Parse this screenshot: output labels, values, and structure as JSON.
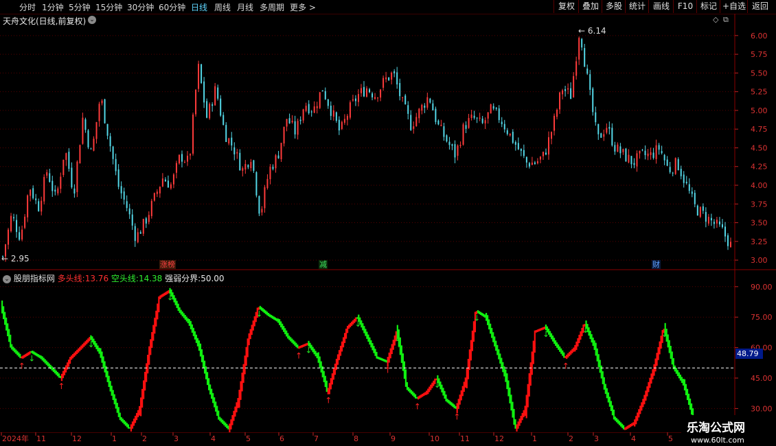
{
  "toolbar": {
    "periods": [
      "分时",
      "1分钟",
      "5分钟",
      "15分钟",
      "30分钟",
      "60分钟",
      "日线",
      "周线",
      "月线",
      "多周期",
      "更多 >"
    ],
    "active_period": "日线",
    "right_buttons": [
      "复权",
      "叠加",
      "多股",
      "统计",
      "画线",
      "F10",
      "标记",
      "+自选",
      "返回"
    ]
  },
  "stock": {
    "title": "天舟文化(日线,前复权)",
    "high_marker": "6.14",
    "low_marker": "2.95"
  },
  "price_axis": [
    "6.00",
    "5.75",
    "5.50",
    "5.25",
    "5.00",
    "4.75",
    "4.50",
    "4.25",
    "4.00",
    "3.75",
    "3.50",
    "3.25",
    "3.00"
  ],
  "events": [
    {
      "label": "涨榜",
      "color": "#ff4040"
    },
    {
      "label": "减",
      "color": "#40e060"
    },
    {
      "label": "财",
      "color": "#5fa0ff"
    }
  ],
  "indicator": {
    "name": "股朋指标网",
    "bull_label": "多头线:",
    "bull_value": "13.76",
    "bear_label": "空头线:",
    "bear_value": "14.38",
    "threshold_label": "强弱分界:",
    "threshold_value": "50.00",
    "current_value": "48.79",
    "axis": [
      "90.00",
      "75.00",
      "60.00",
      "45.00",
      "30.00"
    ]
  },
  "date_axis": [
    "2024年",
    "11",
    "12",
    "1",
    "2",
    "3",
    "4",
    "5",
    "6",
    "7",
    "8",
    "9",
    "10",
    "11",
    "12",
    "1",
    "2",
    "3",
    "4",
    "5"
  ],
  "watermark": {
    "name": "乐淘公式网",
    "url": "www.60lt.com"
  },
  "colors": {
    "up": "#ff3b3b",
    "down": "#54d8e8",
    "bull": "#ff1010",
    "bear": "#10f010",
    "axis": "#c02020",
    "grid": "#5a0000"
  },
  "chart_data": {
    "type": "candlestick",
    "ylim": [
      2.9,
      6.2
    ],
    "price_path": [
      3.05,
      3.6,
      3.3,
      4.0,
      3.7,
      4.2,
      3.8,
      4.5,
      3.9,
      4.9,
      4.4,
      5.2,
      4.6,
      4.0,
      3.7,
      3.3,
      3.5,
      3.8,
      4.1,
      4.0,
      4.4,
      4.3,
      5.6,
      4.9,
      5.3,
      4.7,
      4.5,
      4.2,
      4.4,
      3.6,
      4.2,
      4.4,
      4.9,
      4.7,
      5.1,
      5.0,
      5.3,
      5.0,
      4.7,
      5.0,
      5.2,
      5.3,
      5.2,
      5.4,
      5.5,
      5.1,
      4.8,
      5.0,
      5.2,
      4.8,
      4.6,
      4.4,
      4.8,
      4.9,
      4.8,
      5.0,
      4.9,
      4.7,
      4.5,
      4.3,
      4.3,
      4.4,
      4.8,
      5.3,
      5.2,
      6.1,
      5.3,
      4.6,
      4.8,
      4.5,
      4.4,
      4.3,
      4.4,
      4.4,
      4.5,
      4.2,
      4.3,
      4.0,
      3.7,
      3.6,
      3.5,
      3.4,
      3.2
    ],
    "indicator_ylim": [
      20,
      95
    ],
    "threshold": 50,
    "indicator_path": [
      80,
      60,
      55,
      58,
      55,
      50,
      45,
      55,
      60,
      65,
      57,
      40,
      25,
      20,
      30,
      60,
      85,
      88,
      78,
      72,
      60,
      40,
      25,
      20,
      35,
      65,
      80,
      76,
      73,
      65,
      60,
      62,
      55,
      38,
      55,
      70,
      75,
      65,
      55,
      53,
      68,
      40,
      35,
      38,
      45,
      34,
      30,
      45,
      78,
      75,
      60,
      45,
      20,
      30,
      68,
      70,
      62,
      55,
      60,
      72,
      60,
      40,
      25,
      20,
      23,
      35,
      50,
      70,
      50,
      42,
      25
    ]
  }
}
